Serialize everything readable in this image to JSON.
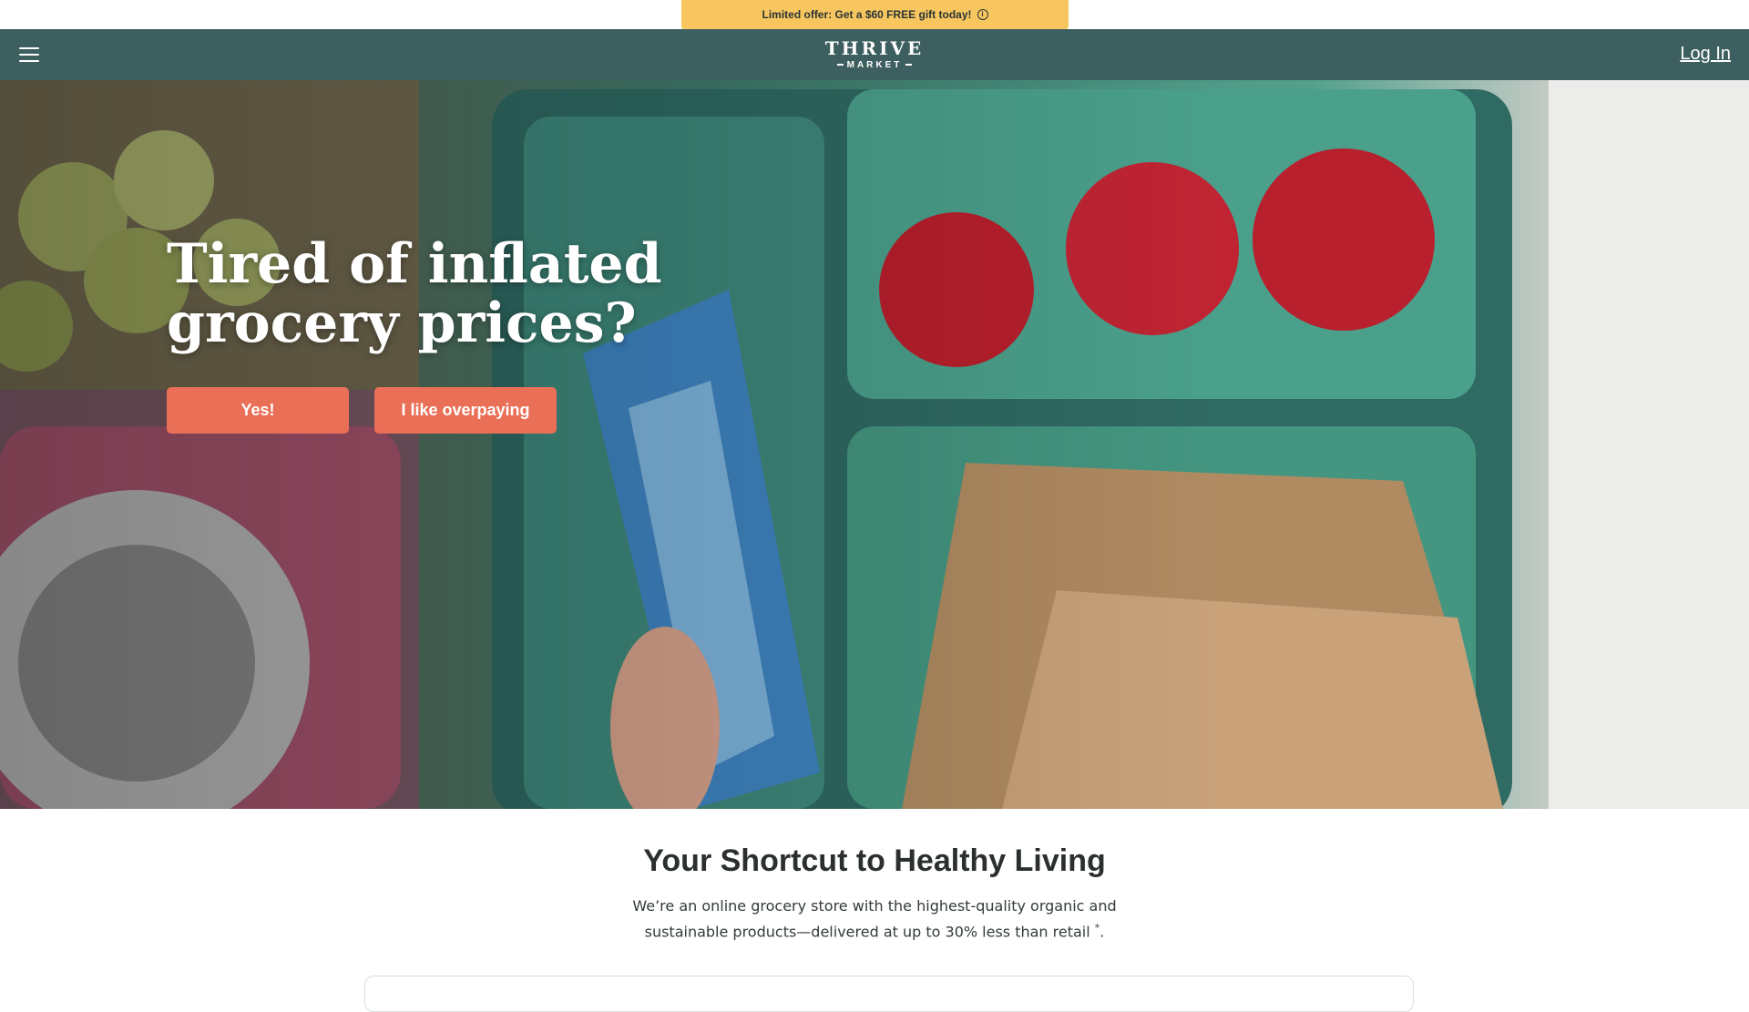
{
  "promo": {
    "text": "Limited offer: Get a $60 FREE gift today!",
    "info_icon": "info-icon"
  },
  "nav": {
    "menu_icon": "hamburger-menu-icon",
    "logo_main": "THRIVE",
    "logo_sub": "MARKET",
    "login_label": "Log In"
  },
  "hero": {
    "title": "Tired of inflated grocery prices?",
    "yes_label": "Yes!",
    "overpay_label": "I like overpaying"
  },
  "intro": {
    "title": "Your Shortcut to Healthy Living",
    "text": "We’re an online grocery store with the highest-quality organic and sustainable products—delivered at up to 30% less than retail",
    "footnote": "*",
    "period": "."
  },
  "colors": {
    "promo_bg": "#f7c65f",
    "nav_bg": "#3e5f5f",
    "cta": "#ea6f57"
  }
}
